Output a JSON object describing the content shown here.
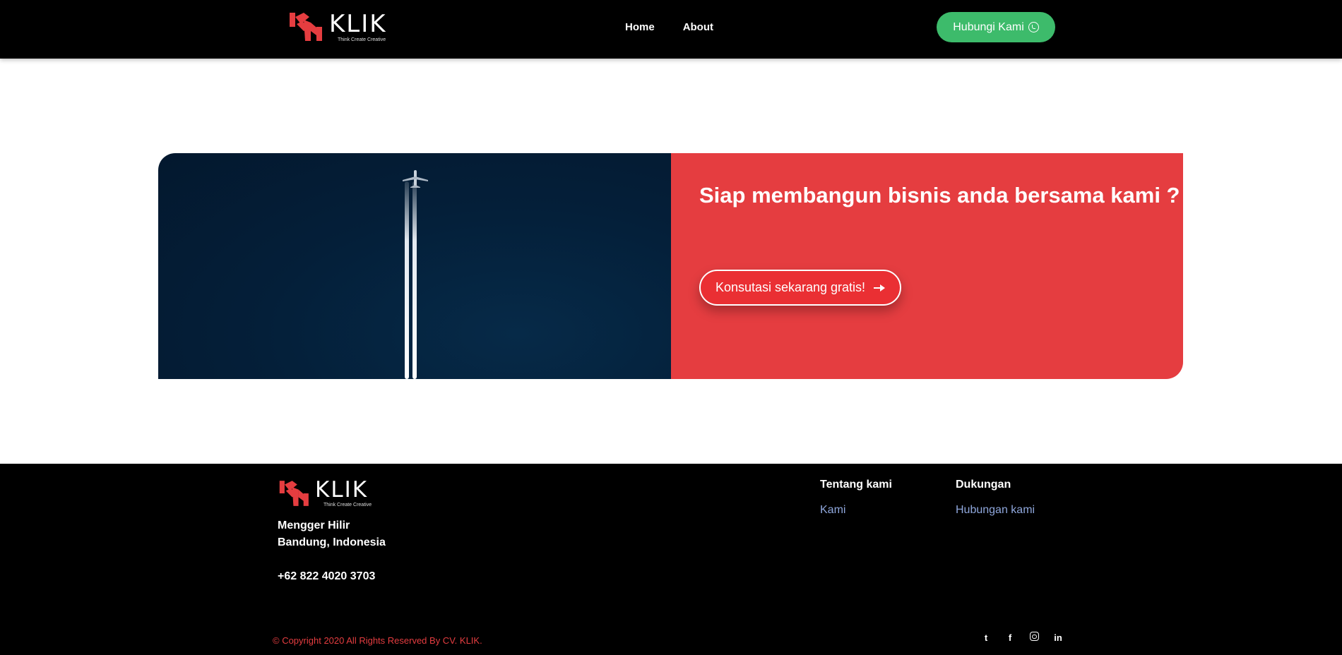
{
  "header": {
    "logo": {
      "word": "KLIK",
      "tagline": "Think Create Creative"
    },
    "nav": [
      {
        "label": "Home"
      },
      {
        "label": "About"
      }
    ],
    "cta_label": "Hubungi Kami"
  },
  "banner": {
    "title": "Siap membangun bisnis anda bersama kami ?",
    "cta_label": "Konsutasi sekarang gratis!"
  },
  "footer": {
    "logo": {
      "word": "KLIK",
      "tagline": "Think Create Creative"
    },
    "address_line1": "Mengger Hilir",
    "address_line2": "Bandung, Indonesia",
    "phone": "+62 822 4020 3703",
    "columns": [
      {
        "heading": "Tentang kami",
        "links": [
          "Kami"
        ]
      },
      {
        "heading": "Dukungan",
        "links": [
          "Hubungan kami"
        ]
      }
    ],
    "copyright": "© Copyright 2020 All Rights Reserved By CV. KLIK.",
    "social": [
      {
        "icon": "twitter-icon",
        "glyph": "t"
      },
      {
        "icon": "facebook-icon",
        "glyph": "f"
      },
      {
        "icon": "instagram-icon",
        "glyph": ""
      },
      {
        "icon": "linkedin-icon",
        "glyph": "in"
      }
    ]
  },
  "colors": {
    "brand_red": "#e53d40",
    "whatsapp_green": "#3dbb6b",
    "link_blue": "#8fa7dc",
    "banner_navy": "#041f39"
  }
}
